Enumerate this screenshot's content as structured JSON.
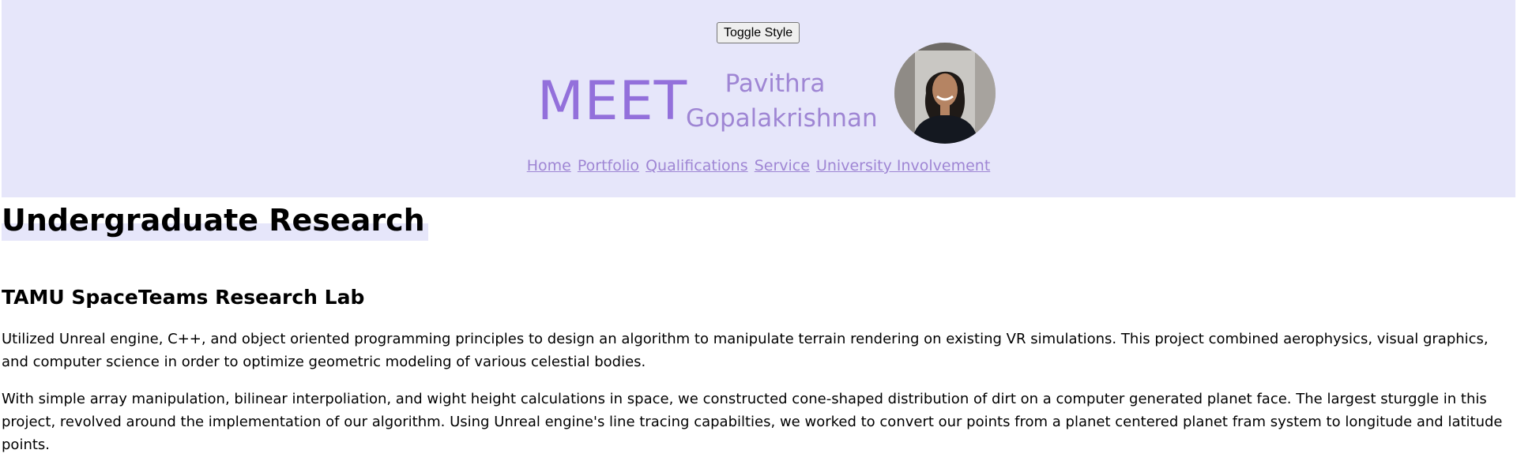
{
  "header": {
    "toggle_label": "Toggle Style",
    "meet": "MEET",
    "first_name": "Pavithra",
    "last_name": "Gopalakrishnan",
    "background_color": "#e6e6fa",
    "accent_color": "#9370db"
  },
  "nav": {
    "items": [
      "Home",
      "Portfolio",
      "Qualifications",
      "Service",
      "University Involvement"
    ]
  },
  "main": {
    "section_title": "Undergraduate Research",
    "subsection_title": "TAMU SpaceTeams Research Lab",
    "paragraphs": [
      "Utilized Unreal engine, C++, and object oriented programming principles to design an algorithm to manipulate terrain rendering on existing VR simulations. This project combined aerophysics, visual graphics, and computer science in order to optimize geometric modeling of various celestial bodies.",
      "With simple array manipulation, bilinear interpoliation, and wight height calculations in space, we constructed cone-shaped distribution of dirt on a computer generated planet face. The largest sturggle in this project, revolved around the implementation of our algorithm. Using Unreal engine's line tracing capabilties, we worked to convert our points from a planet centered planet fram system to longitude and latitude points."
    ]
  }
}
